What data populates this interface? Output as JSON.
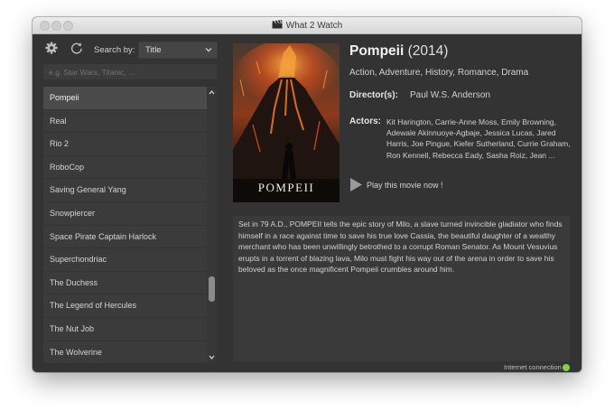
{
  "window": {
    "title": "What 2 Watch"
  },
  "toolbar": {
    "search_by_label": "Search by:",
    "search_by_value": "Title",
    "search_placeholder": "e.g. Star Wars, Titanic, ..."
  },
  "movie_list": {
    "selected_index": 0,
    "items": [
      "Pompeii",
      "Real",
      "Rio 2",
      "RoboCop",
      "Saving General Yang",
      "Snowpiercer",
      "Space Pirate Captain Harlock",
      "Superchondriac",
      "The Duchess",
      "The Legend of Hercules",
      "The Nut Job",
      "The Wolverine"
    ],
    "scroll_position": 0.78
  },
  "movie": {
    "title": "Pompeii",
    "year": "(2014)",
    "poster_text": "POMPEII",
    "genres": "Action, Adventure, History, Romance, Drama",
    "director_label": "Director(s):",
    "director": "Paul W.S. Anderson",
    "actors_label": "Actors:",
    "actors": "Kit Harington, Carrie-Anne Moss, Emily Browning, Adewale Akinnuoye-Agbaje, Jessica Lucas, Jared Harris, Joe Pingue, Kiefer Sutherland, Currie Graham, Ron Kennell, Rebecca Eady, Sasha Roiz, Jean ...",
    "play_label": "Play this movie now !",
    "synopsis": "Set in 79 A.D., POMPEII tells the epic story of Milo, a slave turned invincible gladiator who finds himself in a race against time to save his true love Cassia, the beautiful daughter of a wealthy merchant who has been unwillingly betrothed to a corrupt Roman Senator. As Mount Vesuvius erupts in a torrent of blazing lava, Milo must fight his way out of the arena in order to save his beloved as the once magnificent Pompeii crumbles around him."
  },
  "status": {
    "label": "Internet connection",
    "connected": true,
    "color": "#7ed04b"
  },
  "icons": {
    "app": "clapperboard-icon",
    "settings": "gear-icon",
    "refresh": "refresh-icon",
    "dropdown": "chevron-down-icon",
    "play": "play-icon"
  }
}
